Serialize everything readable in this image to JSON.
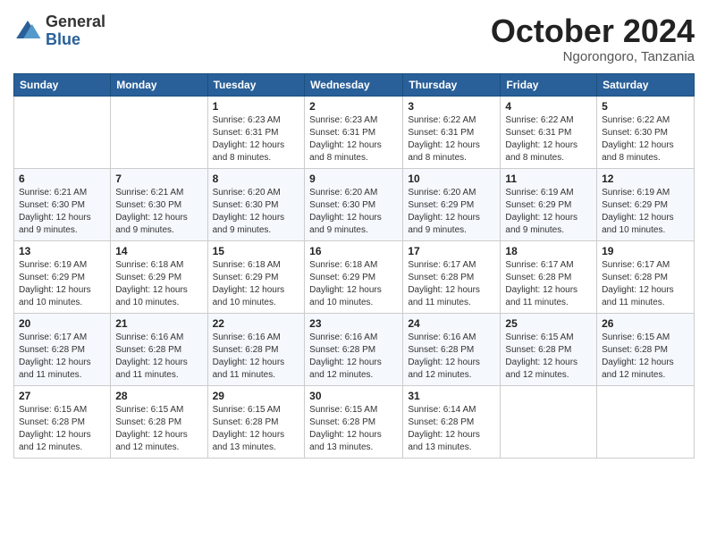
{
  "logo": {
    "general": "General",
    "blue": "Blue"
  },
  "title": "October 2024",
  "location": "Ngorongoro, Tanzania",
  "weekdays": [
    "Sunday",
    "Monday",
    "Tuesday",
    "Wednesday",
    "Thursday",
    "Friday",
    "Saturday"
  ],
  "weeks": [
    [
      {
        "day": "",
        "info": ""
      },
      {
        "day": "",
        "info": ""
      },
      {
        "day": "1",
        "info": "Sunrise: 6:23 AM\nSunset: 6:31 PM\nDaylight: 12 hours and 8 minutes."
      },
      {
        "day": "2",
        "info": "Sunrise: 6:23 AM\nSunset: 6:31 PM\nDaylight: 12 hours and 8 minutes."
      },
      {
        "day": "3",
        "info": "Sunrise: 6:22 AM\nSunset: 6:31 PM\nDaylight: 12 hours and 8 minutes."
      },
      {
        "day": "4",
        "info": "Sunrise: 6:22 AM\nSunset: 6:31 PM\nDaylight: 12 hours and 8 minutes."
      },
      {
        "day": "5",
        "info": "Sunrise: 6:22 AM\nSunset: 6:30 PM\nDaylight: 12 hours and 8 minutes."
      }
    ],
    [
      {
        "day": "6",
        "info": "Sunrise: 6:21 AM\nSunset: 6:30 PM\nDaylight: 12 hours and 9 minutes."
      },
      {
        "day": "7",
        "info": "Sunrise: 6:21 AM\nSunset: 6:30 PM\nDaylight: 12 hours and 9 minutes."
      },
      {
        "day": "8",
        "info": "Sunrise: 6:20 AM\nSunset: 6:30 PM\nDaylight: 12 hours and 9 minutes."
      },
      {
        "day": "9",
        "info": "Sunrise: 6:20 AM\nSunset: 6:30 PM\nDaylight: 12 hours and 9 minutes."
      },
      {
        "day": "10",
        "info": "Sunrise: 6:20 AM\nSunset: 6:29 PM\nDaylight: 12 hours and 9 minutes."
      },
      {
        "day": "11",
        "info": "Sunrise: 6:19 AM\nSunset: 6:29 PM\nDaylight: 12 hours and 9 minutes."
      },
      {
        "day": "12",
        "info": "Sunrise: 6:19 AM\nSunset: 6:29 PM\nDaylight: 12 hours and 10 minutes."
      }
    ],
    [
      {
        "day": "13",
        "info": "Sunrise: 6:19 AM\nSunset: 6:29 PM\nDaylight: 12 hours and 10 minutes."
      },
      {
        "day": "14",
        "info": "Sunrise: 6:18 AM\nSunset: 6:29 PM\nDaylight: 12 hours and 10 minutes."
      },
      {
        "day": "15",
        "info": "Sunrise: 6:18 AM\nSunset: 6:29 PM\nDaylight: 12 hours and 10 minutes."
      },
      {
        "day": "16",
        "info": "Sunrise: 6:18 AM\nSunset: 6:29 PM\nDaylight: 12 hours and 10 minutes."
      },
      {
        "day": "17",
        "info": "Sunrise: 6:17 AM\nSunset: 6:28 PM\nDaylight: 12 hours and 11 minutes."
      },
      {
        "day": "18",
        "info": "Sunrise: 6:17 AM\nSunset: 6:28 PM\nDaylight: 12 hours and 11 minutes."
      },
      {
        "day": "19",
        "info": "Sunrise: 6:17 AM\nSunset: 6:28 PM\nDaylight: 12 hours and 11 minutes."
      }
    ],
    [
      {
        "day": "20",
        "info": "Sunrise: 6:17 AM\nSunset: 6:28 PM\nDaylight: 12 hours and 11 minutes."
      },
      {
        "day": "21",
        "info": "Sunrise: 6:16 AM\nSunset: 6:28 PM\nDaylight: 12 hours and 11 minutes."
      },
      {
        "day": "22",
        "info": "Sunrise: 6:16 AM\nSunset: 6:28 PM\nDaylight: 12 hours and 11 minutes."
      },
      {
        "day": "23",
        "info": "Sunrise: 6:16 AM\nSunset: 6:28 PM\nDaylight: 12 hours and 12 minutes."
      },
      {
        "day": "24",
        "info": "Sunrise: 6:16 AM\nSunset: 6:28 PM\nDaylight: 12 hours and 12 minutes."
      },
      {
        "day": "25",
        "info": "Sunrise: 6:15 AM\nSunset: 6:28 PM\nDaylight: 12 hours and 12 minutes."
      },
      {
        "day": "26",
        "info": "Sunrise: 6:15 AM\nSunset: 6:28 PM\nDaylight: 12 hours and 12 minutes."
      }
    ],
    [
      {
        "day": "27",
        "info": "Sunrise: 6:15 AM\nSunset: 6:28 PM\nDaylight: 12 hours and 12 minutes."
      },
      {
        "day": "28",
        "info": "Sunrise: 6:15 AM\nSunset: 6:28 PM\nDaylight: 12 hours and 12 minutes."
      },
      {
        "day": "29",
        "info": "Sunrise: 6:15 AM\nSunset: 6:28 PM\nDaylight: 12 hours and 13 minutes."
      },
      {
        "day": "30",
        "info": "Sunrise: 6:15 AM\nSunset: 6:28 PM\nDaylight: 12 hours and 13 minutes."
      },
      {
        "day": "31",
        "info": "Sunrise: 6:14 AM\nSunset: 6:28 PM\nDaylight: 12 hours and 13 minutes."
      },
      {
        "day": "",
        "info": ""
      },
      {
        "day": "",
        "info": ""
      }
    ]
  ]
}
